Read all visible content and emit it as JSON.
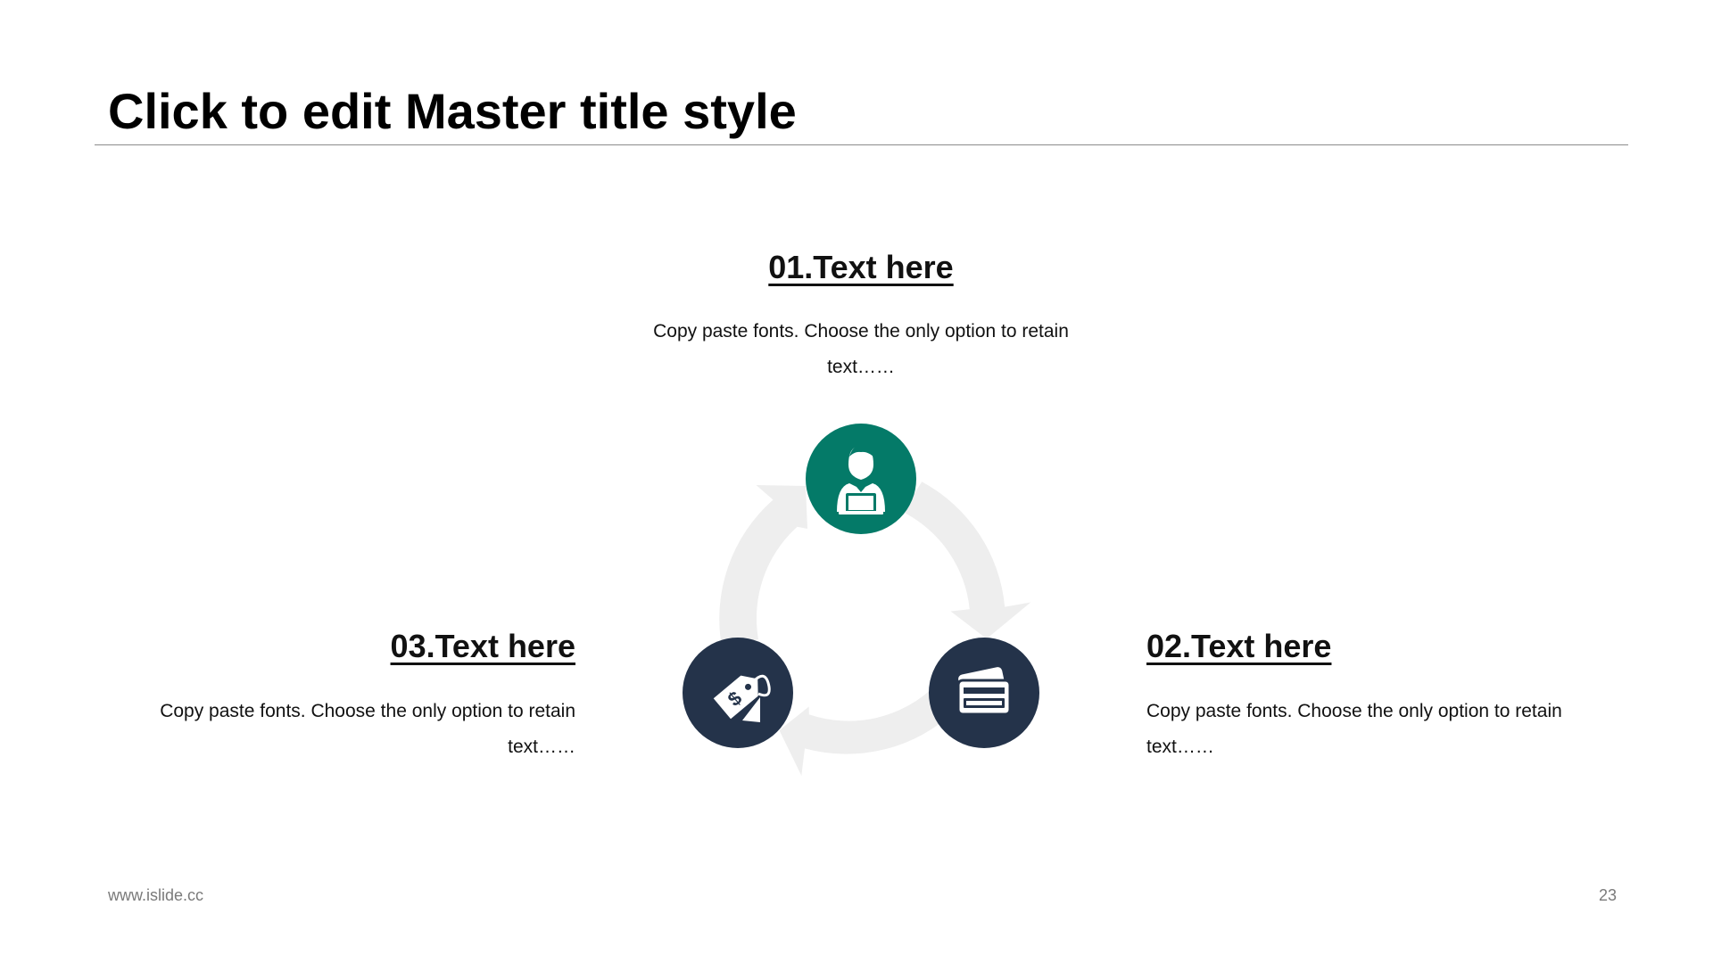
{
  "slide": {
    "title": "Click to edit Master title style",
    "footer_url": "www.islide.cc",
    "page_number": "23"
  },
  "colors": {
    "accent_teal": "#047a68",
    "accent_navy": "#24334a",
    "cycle_arrow": "#eeeeee"
  },
  "steps": [
    {
      "heading": "01.Text here",
      "body": "Copy paste fonts. Choose the only option to retain text……",
      "icon": "person-laptop-icon"
    },
    {
      "heading": "02.Text here",
      "body": "Copy paste fonts. Choose the only option to retain text……",
      "icon": "credit-card-icon"
    },
    {
      "heading": "03.Text here",
      "body": "Copy paste fonts. Choose the only option to retain text……",
      "icon": "price-tag-icon"
    }
  ]
}
